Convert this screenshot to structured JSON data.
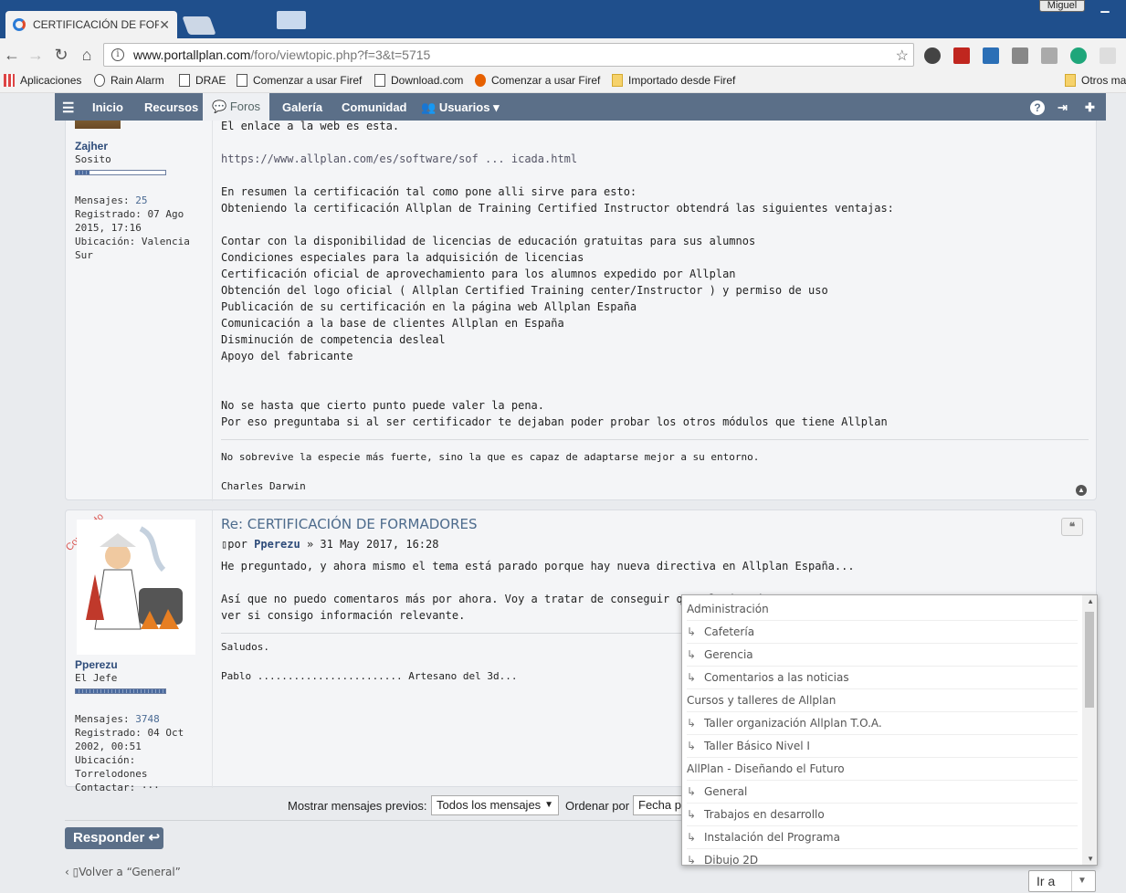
{
  "browser": {
    "tab_title": "CERTIFICACIÓN DE FORM",
    "user": "Miguel",
    "url_host": "www.portallplan.com",
    "url_path": "/foro/viewtopic.php?f=3&t=5715",
    "bookmarks": [
      "Aplicaciones",
      "Rain Alarm",
      "DRAE",
      "Comenzar a usar Firef",
      "Download.com",
      "Comenzar a usar Firef",
      "Importado desde Firef",
      "Otros ma"
    ]
  },
  "nav": {
    "items": [
      "Inicio",
      "Recursos",
      "Foros",
      "Galería",
      "Comunidad",
      "Usuarios"
    ]
  },
  "post1": {
    "author": "Zajher",
    "rank": "Sosito",
    "mensajes_label": "Mensajes:",
    "mensajes": "25",
    "registrado_label": "Registrado:",
    "registrado": "07 Ago 2015, 17:16",
    "ubicacion_label": "Ubicación:",
    "ubicacion": "Valencia Sur",
    "lines": [
      "El enlace a la web es esta.",
      "",
      "https://www.allplan.com/es/software/sof ... icada.html",
      "",
      "En resumen la certificación tal como pone alli sirve para esto:",
      "Obteniendo la certificación Allplan de Training Certified Instructor obtendrá las siguientes ventajas:",
      "",
      "Contar con la disponibilidad de licencias de educación gratuitas para sus alumnos",
      "Condiciones especiales para la adquisición de licencias",
      "Certificación oficial de aprovechamiento para los alumnos expedido por Allplan",
      "Obtención del logo oficial ( Allplan Certified Training center/Instructor ) y permiso de uso",
      "Publicación de su certificación en la página web Allplan España",
      "Comunicación a la base de clientes Allplan en España",
      "Disminución de competencia desleal",
      "Apoyo del fabricante",
      "",
      "",
      "No se hasta que cierto punto puede valer la pena.",
      "Por eso preguntaba si al ser certificador te dejaban poder probar los otros módulos que tiene Allplan"
    ],
    "signature": "No sobrevive la especie más fuerte, sino la que es capaz de adaptarse mejor a su entorno.",
    "signature_author": "Charles Darwin"
  },
  "post2": {
    "online_badge": "Conectado",
    "title": "Re: CERTIFICACIÓN DE FORMADORES",
    "by": "por",
    "author": "Pperezu",
    "date": "» 31 May 2017, 16:28",
    "rank": "El Jefe",
    "mensajes_label": "Mensajes:",
    "mensajes": "3748",
    "registrado_label": "Registrado:",
    "registrado": "04 Oct 2002, 00:51",
    "ubicacion_label": "Ubicación:",
    "ubicacion": "Torrelodones",
    "contactar_label": "Contactar:",
    "contactar": "···",
    "line1": "He preguntado, y ahora mismo el tema está parado porque hay nueva directiva en Allplan España...",
    "line2": "Así que no puedo comentaros más por ahora. Voy a tratar de conseguir que alguien de",
    "line3": "ver si consigo información relevante.",
    "saludos": "Saludos.",
    "firma": "Pablo ........................ Artesano del 3d..."
  },
  "sortbar": {
    "mostrar_label": "Mostrar mensajes previos:",
    "mostrar_value": "Todos los mensajes",
    "ordenar_label": "Ordenar por",
    "ordenar_value": "Fecha p"
  },
  "responder_label": "Responder",
  "volver_label": "Volver a “General”",
  "jump": {
    "button": "Ir a",
    "items": [
      {
        "label": "Administración",
        "sub": false
      },
      {
        "label": "Cafetería",
        "sub": true
      },
      {
        "label": "Gerencia",
        "sub": true
      },
      {
        "label": "Comentarios a las noticias",
        "sub": true
      },
      {
        "label": "Cursos y talleres de Allplan",
        "sub": false
      },
      {
        "label": "Taller organización Allplan T.O.A.",
        "sub": true
      },
      {
        "label": "Taller Básico Nivel I",
        "sub": true
      },
      {
        "label": "AllPlan - Diseñando el Futuro",
        "sub": false
      },
      {
        "label": "General",
        "sub": true
      },
      {
        "label": "Trabajos en desarrollo",
        "sub": true
      },
      {
        "label": "Instalación del Programa",
        "sub": true
      },
      {
        "label": "Dibujo 2D",
        "sub": true
      }
    ]
  },
  "colors": {
    "navbar": "#5b6f88",
    "accent": "#2e4c7a",
    "online": "#d9534f"
  }
}
